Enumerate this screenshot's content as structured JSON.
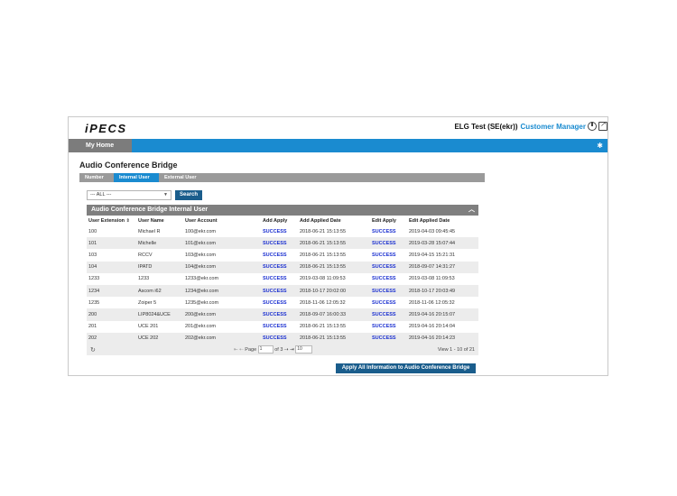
{
  "header": {
    "logo": "iPECS",
    "account": "ELG Test (SE(ekr))",
    "role": "Customer Manager"
  },
  "nav": {
    "home": "My Home"
  },
  "page_title": "Audio Conference Bridge",
  "tabs": [
    {
      "label": "Number",
      "active": false
    },
    {
      "label": "Internal User",
      "active": true
    },
    {
      "label": "External User",
      "active": false
    }
  ],
  "filter": {
    "selected": "--- ALL ---",
    "search_label": "Search"
  },
  "grid": {
    "caption": "Audio Conference Bridge Internal User",
    "columns": [
      "User Extension",
      "User Name",
      "User Account",
      "Add Apply",
      "Add Applied Date",
      "Edit Apply",
      "Edit Applied Date"
    ],
    "rows": [
      [
        "100",
        "Michael R",
        "100@ekr.com",
        "SUCCESS",
        "2018-06-21 15:13:55",
        "SUCCESS",
        "2019-04-03 09:45:45"
      ],
      [
        "101",
        "Michelle",
        "101@ekr.com",
        "SUCCESS",
        "2018-06-21 15:13:55",
        "SUCCESS",
        "2019-03-28 15:07:44"
      ],
      [
        "103",
        "RCCV",
        "103@ekr.com",
        "SUCCESS",
        "2018-06-21 15:13:55",
        "SUCCESS",
        "2019-04-15 15:21:31"
      ],
      [
        "104",
        "IPATD",
        "104@ekr.com",
        "SUCCESS",
        "2018-06-21 15:13:55",
        "SUCCESS",
        "2018-09-07 14:31:27"
      ],
      [
        "1233",
        "1233",
        "1233@ekr.com",
        "SUCCESS",
        "2019-03-08 11:09:53",
        "SUCCESS",
        "2019-03-08 11:09:53"
      ],
      [
        "1234",
        "Ascom i62",
        "1234@ekr.com",
        "SUCCESS",
        "2018-10-17 20:02:00",
        "SUCCESS",
        "2018-10-17 20:03:49"
      ],
      [
        "1235",
        "Zoiper 5",
        "1235@ekr.com",
        "SUCCESS",
        "2018-11-06 12:05:32",
        "SUCCESS",
        "2018-11-06 12:05:32"
      ],
      [
        "200",
        "LIP8024&UCE",
        "200@ekr.com",
        "SUCCESS",
        "2018-09-07 16:00:33",
        "SUCCESS",
        "2019-04-16 20:15:07"
      ],
      [
        "201",
        "UCE 201",
        "201@ekr.com",
        "SUCCESS",
        "2018-06-21 15:13:55",
        "SUCCESS",
        "2019-04-16 20:14:04"
      ],
      [
        "202",
        "UCE 202",
        "202@ekr.com",
        "SUCCESS",
        "2018-06-21 15:13:55",
        "SUCCESS",
        "2019-04-16 20:14:23"
      ]
    ]
  },
  "pager": {
    "page_label": "Page",
    "page_value": "1",
    "of_label": "of 3",
    "page_size": "10",
    "view_text": "View 1 - 10 of 21"
  },
  "apply_button": "Apply All Information to Audio Conference Bridge",
  "colors": {
    "accent": "#1a8bd0",
    "dark_button": "#1a5d8c",
    "success": "#1a2fd0"
  }
}
